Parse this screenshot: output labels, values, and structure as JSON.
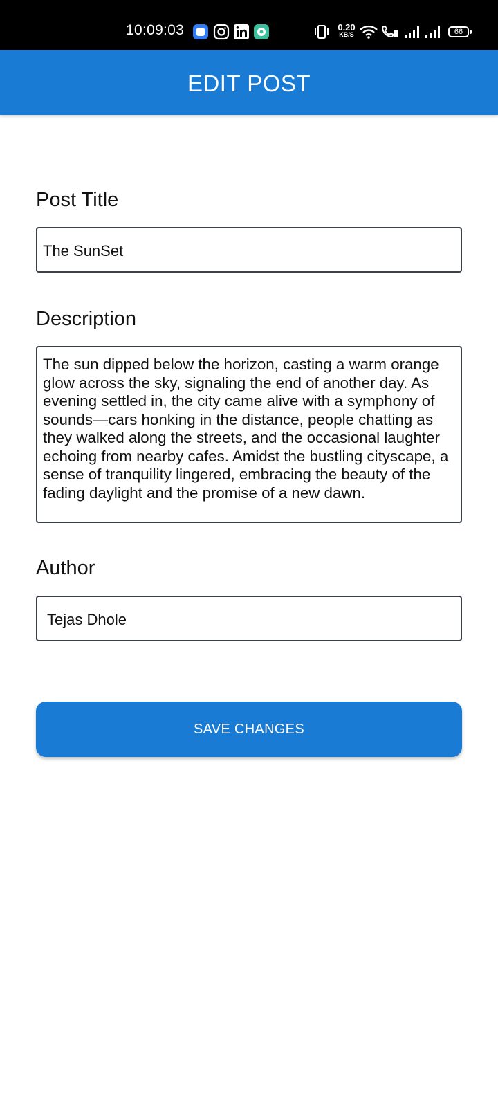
{
  "status_bar": {
    "time": "10:09:03",
    "net_speed": "0.20",
    "net_unit": "KB/S",
    "battery": "66",
    "icons": [
      "app-icon",
      "instagram-icon",
      "linkedin-icon",
      "chat-icon",
      "vibrate-icon",
      "wifi-icon",
      "call-icon",
      "signal-icon",
      "signal-icon",
      "battery-icon"
    ]
  },
  "app_bar": {
    "title": "EDIT POST",
    "color": "#1a7bd4"
  },
  "form": {
    "title_label": "Post Title",
    "title_value": "The SunSet",
    "description_label": "Description",
    "description_value": "The sun dipped below the horizon, casting a warm orange glow across the sky, signaling the end of another day. As evening settled in, the city came alive with a symphony of sounds—cars honking in the distance, people chatting as they walked along the streets, and the occasional laughter echoing from nearby cafes. Amidst the bustling cityscape, a sense of tranquility lingered, embracing the beauty of the fading daylight and the promise of a new dawn.",
    "author_label": "Author",
    "author_value": "Tejas Dhole"
  },
  "actions": {
    "save_label": "SAVE CHANGES"
  }
}
